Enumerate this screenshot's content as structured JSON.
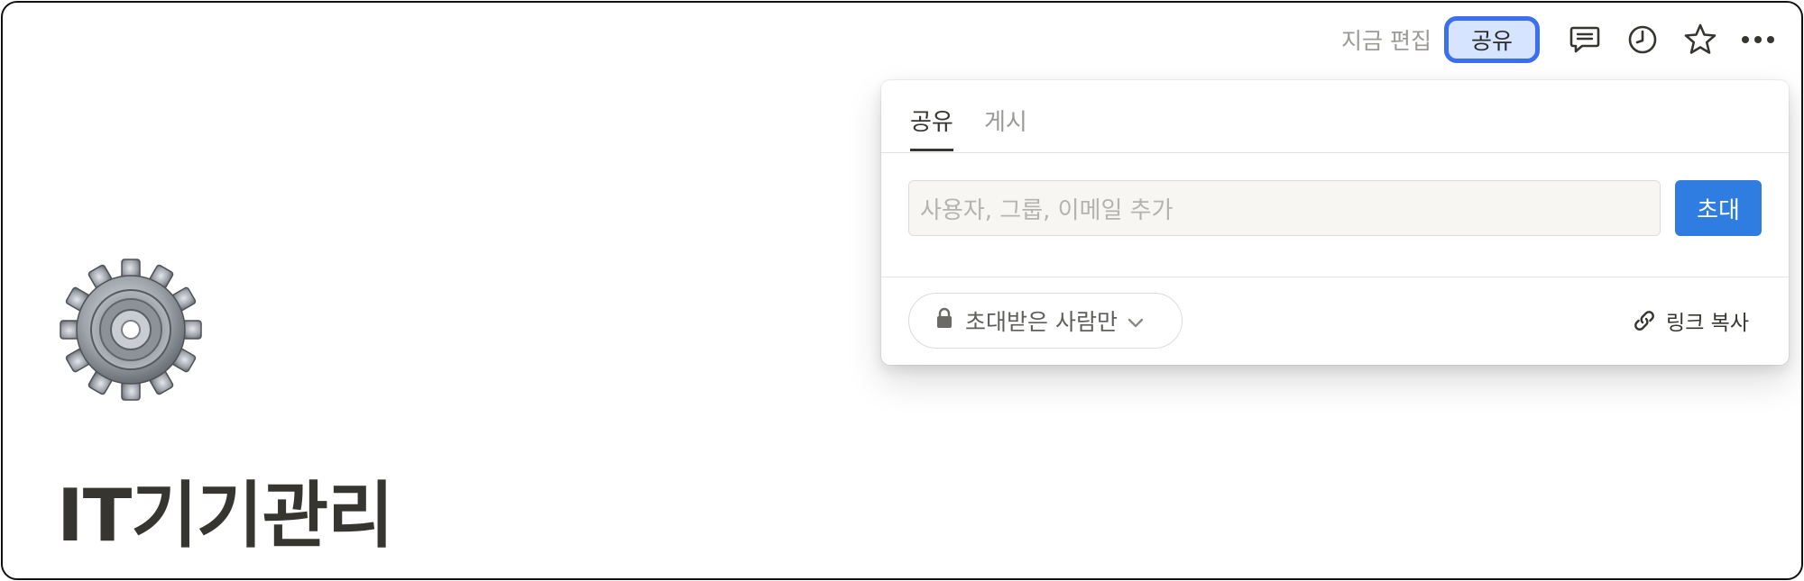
{
  "topbar": {
    "edited_label": "지금 편집",
    "share_label": "공유",
    "icons": [
      "comment-icon",
      "clock-icon",
      "star-icon",
      "more-icon"
    ]
  },
  "share_popover": {
    "tabs": [
      {
        "label": "공유",
        "active": true
      },
      {
        "label": "게시",
        "active": false
      }
    ],
    "invite_input": {
      "placeholder": "사용자, 그룹, 이메일 추가",
      "value": ""
    },
    "invite_button_label": "초대",
    "access_label": "초대받은 사람만",
    "copy_link_label": "링크 복사"
  },
  "page": {
    "icon": "gear-icon",
    "title": "IT기기관리"
  },
  "colors": {
    "accent": "#2f7de1",
    "highlight_border": "#3b6ff0",
    "highlight_fill": "#d6e4ff",
    "text": "#37352f",
    "muted": "#9b9a97"
  }
}
